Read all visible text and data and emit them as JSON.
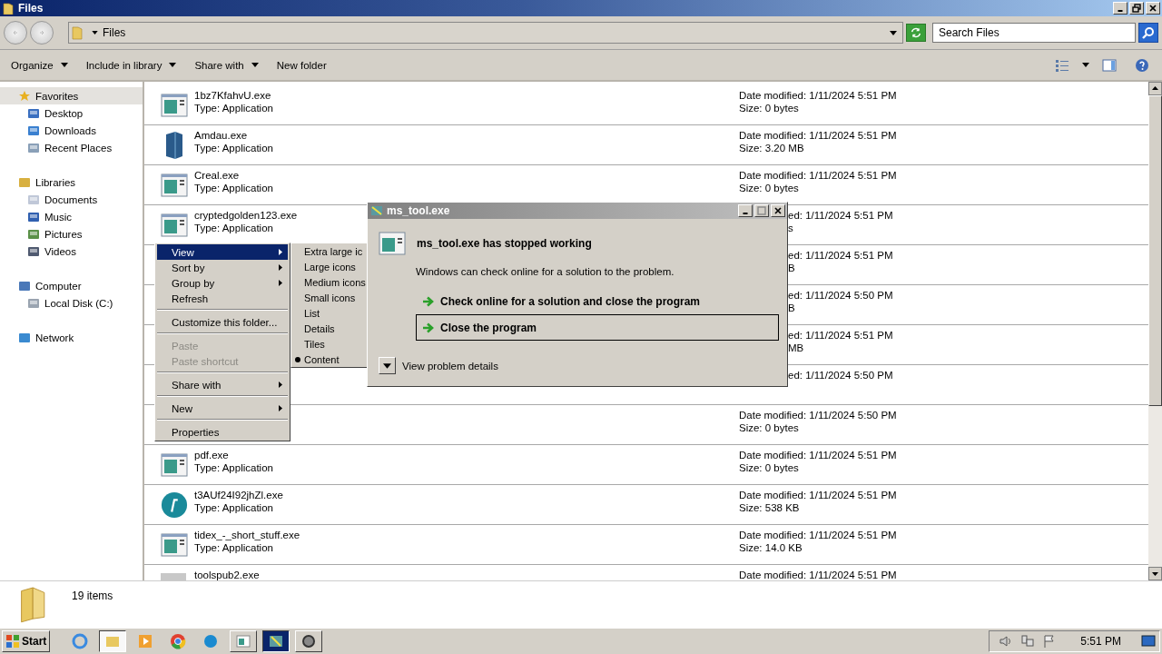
{
  "window": {
    "title": "Files"
  },
  "address": {
    "path": "Files",
    "search_placeholder": "Search Files"
  },
  "toolbar": [
    {
      "label": "Organize",
      "dropdown": true
    },
    {
      "label": "Include in library",
      "dropdown": true
    },
    {
      "label": "Share with",
      "dropdown": true
    },
    {
      "label": "New folder",
      "dropdown": false
    }
  ],
  "sidebar": [
    {
      "label": "Favorites",
      "kind": "star",
      "selected": true,
      "children": [
        {
          "label": "Desktop",
          "kind": "desktop",
          "selected": false
        },
        {
          "label": "Downloads",
          "kind": "downloads",
          "selected": false
        },
        {
          "label": "Recent Places",
          "kind": "recent",
          "selected": false
        }
      ]
    },
    {
      "label": "Libraries",
      "kind": "library",
      "selected": false,
      "children": [
        {
          "label": "Documents",
          "kind": "documents",
          "selected": false
        },
        {
          "label": "Music",
          "kind": "music",
          "selected": false
        },
        {
          "label": "Pictures",
          "kind": "pictures",
          "selected": false
        },
        {
          "label": "Videos",
          "kind": "videos",
          "selected": false
        }
      ]
    },
    {
      "label": "Computer",
      "kind": "computer",
      "selected": false,
      "children": [
        {
          "label": "Local Disk (C:)",
          "kind": "disk",
          "selected": false
        }
      ]
    },
    {
      "label": "Network",
      "kind": "network",
      "selected": false
    }
  ],
  "files": [
    {
      "name": "1bz7KfahvU.exe",
      "type": "Type: Application",
      "kind": "app",
      "date": "Date modified: 1/11/2024 5:51 PM",
      "size": "Size: 0 bytes"
    },
    {
      "name": "Amdau.exe",
      "type": "Type: Application",
      "kind": "box",
      "date": "Date modified: 1/11/2024 5:51 PM",
      "size": "Size: 3.20 MB"
    },
    {
      "name": "Creal.exe",
      "type": "Type: Application",
      "kind": "app",
      "date": "Date modified: 1/11/2024 5:51 PM",
      "size": "Size: 0 bytes"
    },
    {
      "name": "cryptedgolden123.exe",
      "type": "Type: Application",
      "kind": "app",
      "date_tail": "ed: 1/11/2024 5:51 PM",
      "size_tail": "s"
    },
    {
      "date_tail": "ed: 1/11/2024 5:51 PM",
      "size_tail": "B"
    },
    {
      "date_tail": "ed: 1/11/2024 5:50 PM",
      "size_tail": "B"
    },
    {
      "date_tail": "ed: 1/11/2024 5:51 PM",
      "size_tail": "MB"
    },
    {
      "date_tail": "ed: 1/11/2024 5:50 PM"
    },
    {
      "date": "Date modified: 1/11/2024 5:50 PM",
      "size": "Size: 0 bytes"
    },
    {
      "name": "pdf.exe",
      "type": "Type: Application",
      "kind": "app",
      "date": "Date modified: 1/11/2024 5:51 PM",
      "size": "Size: 0 bytes"
    },
    {
      "name": "t3AUf24I92jhZl.exe",
      "type": "Type: Application",
      "kind": "circle",
      "date": "Date modified: 1/11/2024 5:51 PM",
      "size": "Size: 538 KB"
    },
    {
      "name": "tidex_-_short_stuff.exe",
      "type": "Type: Application",
      "kind": "app",
      "date": "Date modified: 1/11/2024 5:51 PM",
      "size": "Size: 14.0 KB"
    },
    {
      "name": "toolspub2.exe",
      "kind": "blank",
      "date": "Date modified: 1/11/2024 5:51 PM"
    }
  ],
  "context_menu": [
    {
      "kind": "item",
      "label": "View",
      "submenu": true,
      "selected": true,
      "disabled": false
    },
    {
      "kind": "item",
      "label": "Sort by",
      "submenu": true,
      "selected": false,
      "disabled": false
    },
    {
      "kind": "item",
      "label": "Group by",
      "submenu": true,
      "selected": false,
      "disabled": false
    },
    {
      "kind": "item",
      "label": "Refresh",
      "submenu": false,
      "selected": false,
      "disabled": false
    },
    {
      "kind": "separator"
    },
    {
      "kind": "item",
      "label": "Customize this folder...",
      "submenu": false,
      "selected": false,
      "disabled": false
    },
    {
      "kind": "separator"
    },
    {
      "kind": "item",
      "label": "Paste",
      "submenu": false,
      "selected": false,
      "disabled": true
    },
    {
      "kind": "item",
      "label": "Paste shortcut",
      "submenu": false,
      "selected": false,
      "disabled": true
    },
    {
      "kind": "separator"
    },
    {
      "kind": "item",
      "label": "Share with",
      "submenu": true,
      "selected": false,
      "disabled": false
    },
    {
      "kind": "separator"
    },
    {
      "kind": "item",
      "label": "New",
      "submenu": true,
      "selected": false,
      "disabled": false
    },
    {
      "kind": "separator"
    },
    {
      "kind": "item",
      "label": "Properties",
      "submenu": false,
      "selected": false,
      "disabled": false
    }
  ],
  "view_submenu": [
    {
      "label": "Extra large ic",
      "checked": false
    },
    {
      "label": "Large icons",
      "checked": false
    },
    {
      "label": "Medium icons",
      "checked": false
    },
    {
      "label": "Small icons",
      "checked": false
    },
    {
      "label": "List",
      "checked": false
    },
    {
      "label": "Details",
      "checked": false
    },
    {
      "label": "Tiles",
      "checked": false
    },
    {
      "label": "Content",
      "checked": true
    }
  ],
  "dialog": {
    "title": "ms_tool.exe",
    "heading": "ms_tool.exe has stopped working",
    "message": "Windows can check online for a solution to the problem.",
    "options": [
      {
        "label": "Check online for a solution and close the program",
        "selected": false
      },
      {
        "label": "Close the program",
        "selected": true
      }
    ],
    "details_label": "View problem details"
  },
  "status_bar": {
    "count": "19 items"
  },
  "taskbar": {
    "start": "Start",
    "apps": [
      {
        "kind": "ie",
        "selected": false
      },
      {
        "kind": "explorer",
        "selected": true
      },
      {
        "kind": "media",
        "selected": false
      },
      {
        "kind": "chrome",
        "selected": false
      },
      {
        "kind": "edge",
        "selected": false
      },
      {
        "kind": "window",
        "selected": false
      },
      {
        "kind": "crash",
        "selected": true
      },
      {
        "kind": "gear",
        "selected": false
      }
    ],
    "time": "5:51 PM"
  }
}
